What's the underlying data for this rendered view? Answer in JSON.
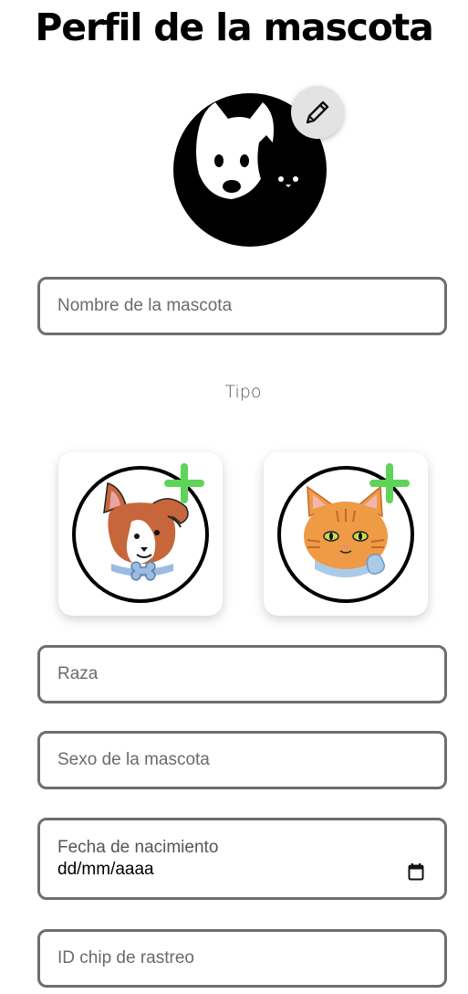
{
  "header": {
    "title": "Perfil de la mascota"
  },
  "avatar": {
    "icon": "dog-cat-logo-icon",
    "edit_icon": "pencil-icon"
  },
  "form": {
    "name_placeholder": "Nombre de la mascota",
    "type_label": "Tipo",
    "types": [
      {
        "name": "dog",
        "icon": "dog-icon",
        "badge": "plus-icon"
      },
      {
        "name": "cat",
        "icon": "cat-icon",
        "badge": "plus-icon"
      }
    ],
    "breed_placeholder": "Raza",
    "sex_placeholder": "Sexo de la mascota",
    "birthdate_label": "Fecha de nacimiento",
    "birthdate_value": "dd/mm/aaaa",
    "chip_placeholder": "ID chip de rastreo"
  },
  "colors": {
    "accent_green": "#5fd35a",
    "border": "#6e6e6e"
  }
}
